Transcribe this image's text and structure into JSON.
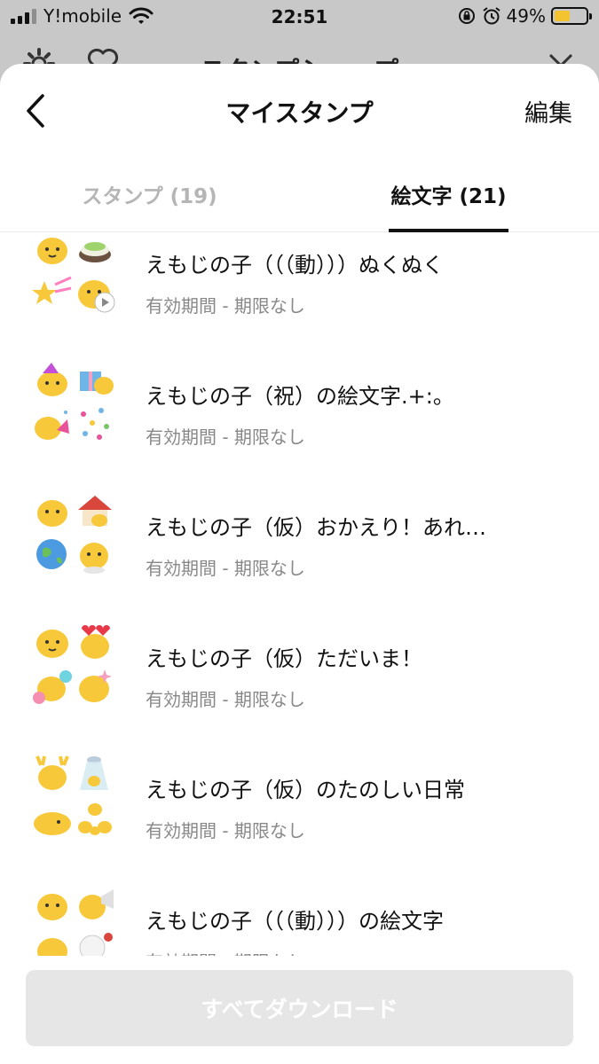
{
  "status_bar": {
    "carrier": "Y!mobile",
    "time": "22:51",
    "battery": "49%",
    "battery_level": 0.49
  },
  "background": {
    "title": "スタンプショップ"
  },
  "nav": {
    "title": "マイスタンプ",
    "edit_label": "編集"
  },
  "tabs": [
    {
      "label": "スタンプ (19)",
      "active": false
    },
    {
      "label": "絵文字 (21)",
      "active": true
    }
  ],
  "items": [
    {
      "title": "えもじの子（（（動）））ぬくぬく",
      "subtitle": "有効期間 - 期限なし"
    },
    {
      "title": "えもじの子（祝）の絵文字.+:。",
      "subtitle": "有効期間 - 期限なし"
    },
    {
      "title": "えもじの子（仮）おかえり！あれ…",
      "subtitle": "有効期間 - 期限なし"
    },
    {
      "title": "えもじの子（仮）ただいま！",
      "subtitle": "有効期間 - 期限なし"
    },
    {
      "title": "えもじの子（仮）のたのしい日常",
      "subtitle": "有効期間 - 期限なし"
    },
    {
      "title": "えもじの子（（（動）））の絵文字",
      "subtitle": "有効期間 - 期限なし"
    }
  ],
  "download_button": "すべてダウンロード",
  "colors": {
    "emoji_yellow": "#f7c93a",
    "button_disabled": "#e6e6e6",
    "tab_inactive": "#b5b5b5"
  }
}
